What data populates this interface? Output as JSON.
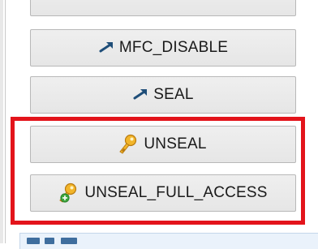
{
  "buttons": {
    "top_partial": {
      "label": ""
    },
    "mfc_disable": {
      "label": "MFC_DISABLE",
      "icon": "arrow-icon"
    },
    "seal": {
      "label": "SEAL",
      "icon": "arrow-icon"
    },
    "unseal": {
      "label": "UNSEAL",
      "icon": "key-icon"
    },
    "unseal_full_access": {
      "label": "UNSEAL_FULL_ACCESS",
      "icon": "key-add-icon"
    }
  },
  "colors": {
    "highlight": "#e3141b",
    "button_bg": "#ececec",
    "button_border": "#b8b8b8",
    "arrow": "#1f4e79",
    "key": "#e0a21c"
  }
}
